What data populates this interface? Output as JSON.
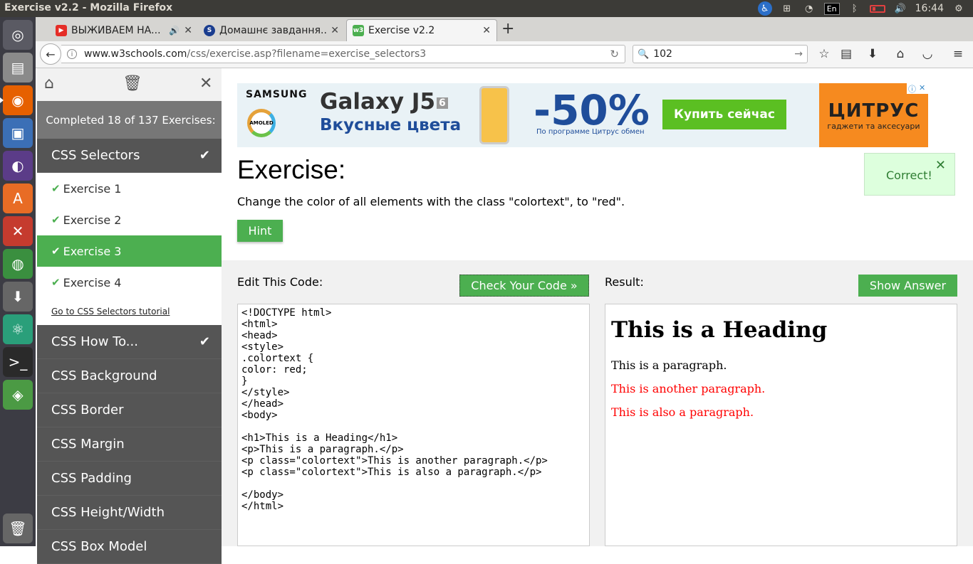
{
  "window": {
    "title": "Exercise v2.2 - Mozilla Firefox",
    "time": "16:44",
    "lang": "En"
  },
  "tabs": [
    {
      "label": "ВЫЖИВАЕМ НА...",
      "icon": "youtube-icon"
    },
    {
      "label": "Домашнє завдання...",
      "icon": "skype-icon"
    },
    {
      "label": "Exercise v2.2",
      "icon": "w3schools-icon",
      "active": true
    }
  ],
  "nav": {
    "url_domain": "www.w3schools.com",
    "url_path": "/css/exercise.asp?filename=exercise_selectors3",
    "search_value": "102"
  },
  "sidebar": {
    "progress": "Completed 18 of 137 Exercises:",
    "current_category": "CSS Selectors",
    "exercises": [
      "Exercise 1",
      "Exercise 2",
      "Exercise 3",
      "Exercise 4"
    ],
    "selected_exercise": "Exercise 3",
    "tutorial_link": "Go to CSS Selectors tutorial",
    "categories": [
      "CSS How To...",
      "CSS Background",
      "CSS Border",
      "CSS Margin",
      "CSS Padding",
      "CSS Height/Width",
      "CSS Box Model"
    ]
  },
  "ad": {
    "brand": "SAMSUNG",
    "amoled": "AMOLED",
    "product": "Galaxy J5",
    "product_badge": "6",
    "tagline": "Вкусные цвета",
    "discount": "-50%",
    "program": "По программе Цитрус обмен",
    "cta": "Купить сейчас",
    "store": "ЦИТРУС",
    "store_sub": "гаджети та аксесуари"
  },
  "exercise": {
    "heading": "Exercise:",
    "task": "Change the color of all elements with the class \"colortext\", to \"red\".",
    "hint_label": "Hint",
    "correct_msg": "Correct!"
  },
  "editor": {
    "label": "Edit This Code:",
    "check_label": "Check Your Code »",
    "code": "<!DOCTYPE html>\n<html>\n<head>\n<style>\n.colortext {\ncolor: red;\n}\n</style>\n</head>\n<body>\n\n<h1>This is a Heading</h1>\n<p>This is a paragraph.</p>\n<p class=\"colortext\">This is another paragraph.</p>\n<p class=\"colortext\">This is also a paragraph.</p>\n\n</body>\n</html>"
  },
  "result": {
    "label": "Result:",
    "show_answer_label": "Show Answer",
    "heading": "This is a Heading",
    "p1": "This is a paragraph.",
    "p2": "This is another paragraph.",
    "p3": "This is also a paragraph."
  },
  "colors": {
    "accent": "#4caf50",
    "sidebar": "#555555",
    "result_red": "#ff0000"
  }
}
